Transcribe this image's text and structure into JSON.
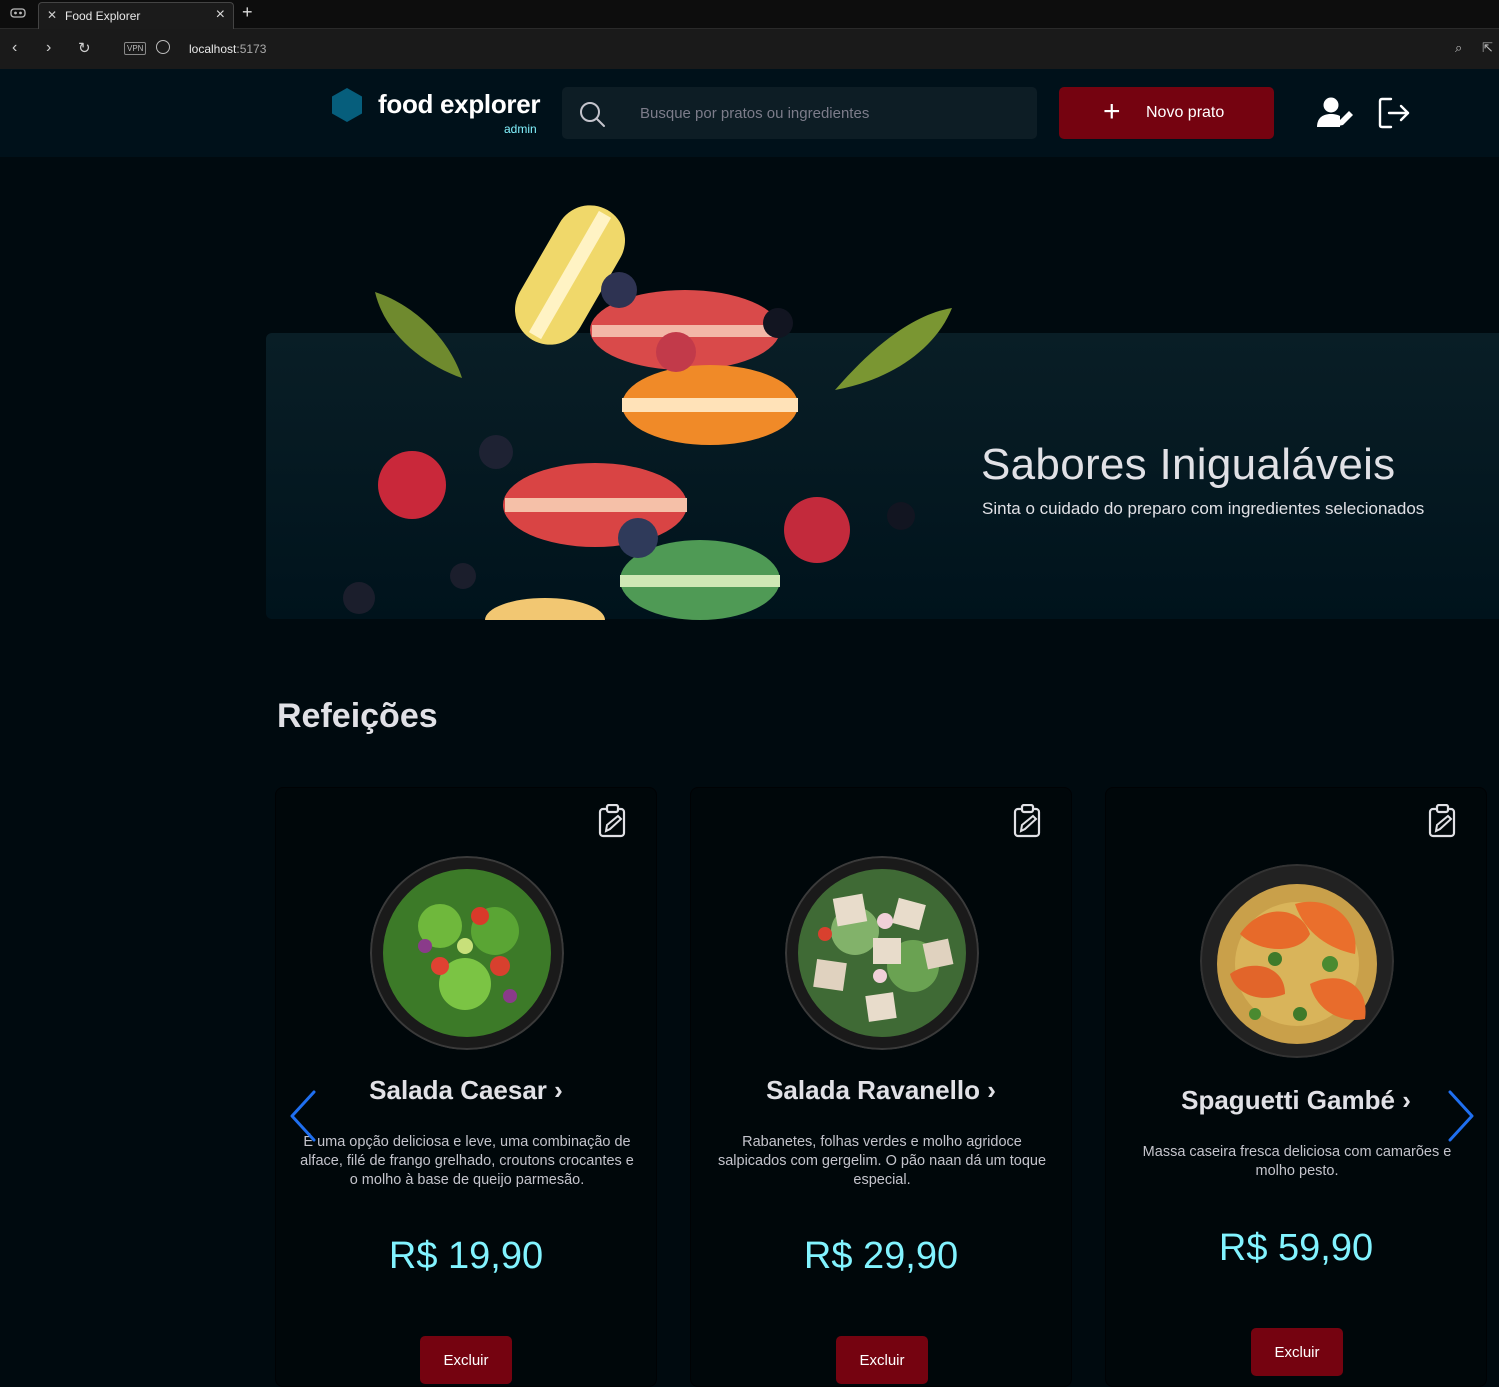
{
  "browser": {
    "tab_title": "Food Explorer",
    "url_host": "localhost",
    "url_port": ":5173",
    "vpn_label": "VPN"
  },
  "header": {
    "logo_text": "food explorer",
    "logo_sub": "admin",
    "search_placeholder": "Busque por pratos ou ingredientes",
    "new_dish_label": "Novo prato",
    "accent_color": "#750310",
    "brand_color": "#065e7c"
  },
  "banner": {
    "title": "Sabores Inigualáveis",
    "subtitle": "Sinta o cuidado do preparo com ingredientes selecionados"
  },
  "section": {
    "title": "Refeições"
  },
  "dishes": [
    {
      "name": "Salada Caesar",
      "description": "É uma opção deliciosa e leve, uma combinação de alface, filé de frango grelhado, croutons crocantes e o molho à base de queijo parmesão.",
      "price": "R$ 19,90",
      "delete_label": "Excluir"
    },
    {
      "name": "Salada Ravanello",
      "description": "Rabanetes, folhas verdes e molho agridoce salpicados com gergelim. O pão naan dá um toque especial.",
      "price": "R$ 29,90",
      "delete_label": "Excluir"
    },
    {
      "name": "Spaguetti Gambé",
      "description": "Massa caseira fresca deliciosa com camarões e molho pesto.",
      "price": "R$ 59,90",
      "delete_label": "Excluir"
    }
  ]
}
